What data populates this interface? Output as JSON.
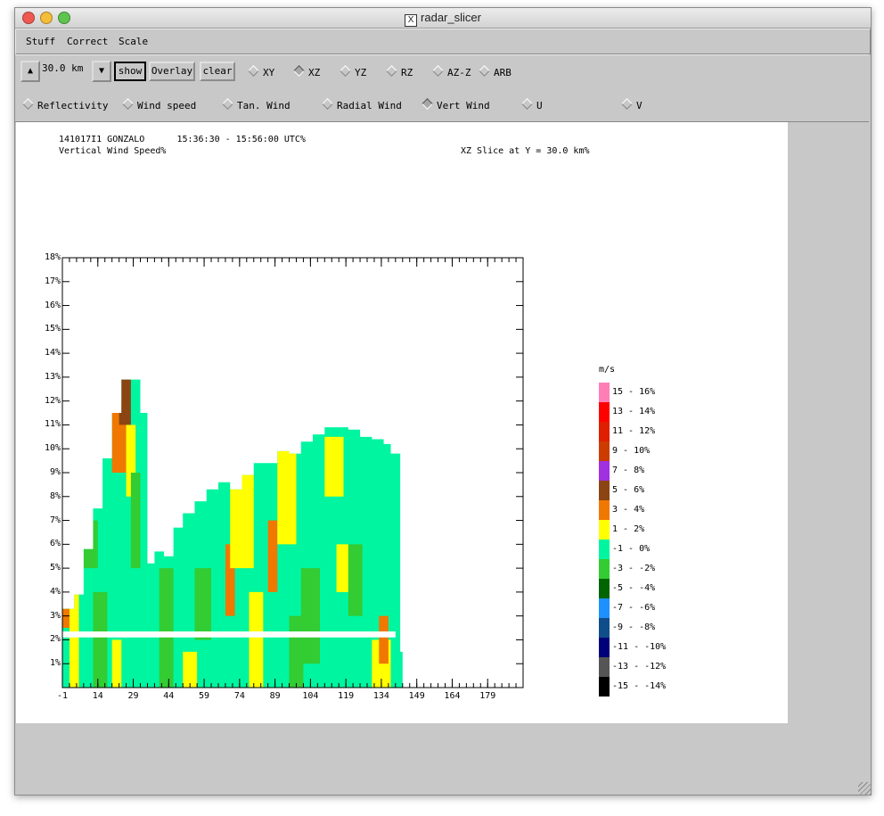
{
  "window": {
    "title": "radar_slicer"
  },
  "menus": [
    "Stuff",
    "Correct",
    "Scale"
  ],
  "toolbar": {
    "range_value": "30.0 km",
    "show_label": "show",
    "overlay_label": "Overlay",
    "clear_label": "clear",
    "slice_modes": [
      {
        "label": "XY",
        "selected": false
      },
      {
        "label": "XZ",
        "selected": true
      },
      {
        "label": "YZ",
        "selected": false
      },
      {
        "label": "RZ",
        "selected": false
      },
      {
        "label": "AZ-Z",
        "selected": false
      },
      {
        "label": "ARB",
        "selected": false
      }
    ],
    "fields": [
      {
        "label": "Reflectivity",
        "selected": false
      },
      {
        "label": "Wind speed",
        "selected": false
      },
      {
        "label": "Tan. Wind",
        "selected": false
      },
      {
        "label": "Radial Wind",
        "selected": false
      },
      {
        "label": "Vert Wind",
        "selected": true
      },
      {
        "label": "U",
        "selected": false
      },
      {
        "label": "V",
        "selected": false
      }
    ]
  },
  "plot": {
    "header_left_line1": "141017I1 GONZALO      15:36:30 - 15:56:00 UTC%",
    "header_left_line2": "Vertical Wind Speed%",
    "header_right": "XZ Slice at Y = 30.0 km%"
  },
  "chart_data": {
    "type": "heatmap",
    "title": "Vertical Wind Speed%",
    "subtitle": "XZ Slice at Y = 30.0 km%",
    "y_tick_labels": [
      "18%",
      "17%",
      "16%",
      "15%",
      "14%",
      "13%",
      "12%",
      "11%",
      "10%",
      "9%",
      "8%",
      "7%",
      "6%",
      "5%",
      "4%",
      "3%",
      "2%",
      "1%"
    ],
    "x_tick_labels": [
      "-1",
      "14",
      "29",
      "44",
      "59",
      "74",
      "89",
      "104",
      "119",
      "134",
      "149",
      "164",
      "179"
    ],
    "xlim": [
      -1,
      194
    ],
    "ylim": [
      0,
      18
    ],
    "colorbar_unit": "m/s",
    "colorbar": [
      {
        "label": "15 - 16%",
        "color": "#ff7eb6"
      },
      {
        "label": "13 - 14%",
        "color": "#ff0000"
      },
      {
        "label": "11 - 12%",
        "color": "#e01e00"
      },
      {
        "label": "9 - 10%",
        "color": "#cc3c00"
      },
      {
        "label": "7 - 8%",
        "color": "#a030e0"
      },
      {
        "label": "5 - 6%",
        "color": "#8b4513"
      },
      {
        "label": "3 - 4%",
        "color": "#f07800"
      },
      {
        "label": "1 - 2%",
        "color": "#ffff00"
      },
      {
        "label": "-1 - 0%",
        "color": "#00f5a0"
      },
      {
        "label": "-3 - -2%",
        "color": "#33cc33"
      },
      {
        "label": "-5 - -4%",
        "color": "#006400"
      },
      {
        "label": "-7 - -6%",
        "color": "#1e90ff"
      },
      {
        "label": "-9 - -8%",
        "color": "#104e8b"
      },
      {
        "label": "-11 - -10%",
        "color": "#00007a"
      },
      {
        "label": "-13 - -12%",
        "color": "#555555"
      },
      {
        "label": "-15 - -14%",
        "color": "#000000"
      }
    ],
    "echo_profile": {
      "x_km": [
        -1,
        2,
        4,
        8,
        12,
        16,
        20,
        24,
        28,
        32,
        35,
        38,
        42,
        46,
        50,
        55,
        60,
        65,
        70,
        75,
        80,
        85,
        90,
        95,
        100,
        105,
        110,
        115,
        120,
        125,
        130,
        135,
        138,
        142,
        143
      ],
      "top_km": [
        3.3,
        3.3,
        3.9,
        5.8,
        7.5,
        9.6,
        11.5,
        12.9,
        12.9,
        11.5,
        5.2,
        5.7,
        5.5,
        6.7,
        7.3,
        7.8,
        8.3,
        8.6,
        8.3,
        8.9,
        9.4,
        9.4,
        9.9,
        9.8,
        10.3,
        10.6,
        10.9,
        10.9,
        10.8,
        10.5,
        10.4,
        10.2,
        9.8,
        1.5,
        0.8
      ]
    },
    "gap_km": 2.2
  }
}
